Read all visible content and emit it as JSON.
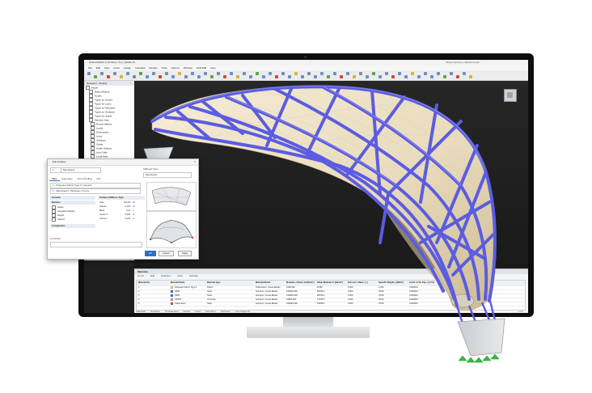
{
  "app": {
    "title": "Dlubal RFEM | 6.04.0012 | Tent_Saddle.rf6",
    "window_right": "Online Services | Dlubal Center",
    "menus": [
      "File",
      "Edit",
      "View",
      "Insert",
      "Assign",
      "Calculate",
      "Results",
      "Tools",
      "Options",
      "Window",
      "CAD-BIM",
      "Help"
    ]
  },
  "navigator": {
    "tabs": [
      "Navigator - Display"
    ],
    "items": [
      "Model",
      "Basic Objects",
      "Nodes",
      "Types for Nodes",
      "Types for Lines",
      "Types for Members",
      "Types for Surfaces",
      "Types for Solids",
      "Member Sets",
      "Result Objects",
      "Loads",
      "Dimensions",
      "Lines",
      "Surfaces",
      "Solids",
      "Guide Objects",
      "Line Grids",
      "Local Axes",
      "Results",
      "Mesh Nodes",
      "Values on Surfaces",
      "Member Results",
      "Extremes",
      "Support Reactions",
      "Result Sections",
      "Load Wizards"
    ],
    "bottom": [
      "Clipping Planes",
      "Views"
    ]
  },
  "colors": {
    "member": "#5b5ce0",
    "membrane": "#efe3c8",
    "support": "#2fbf3a",
    "background": "#1c1c1c"
  },
  "dialog": {
    "title": "Edit Surface",
    "fields": {
      "no": "1",
      "name": "Membrane",
      "stiffness_label": "Stiffness Type",
      "stiffness_value": "Membrane",
      "material": "1 - Polyester Fabric Type II | Generic",
      "thickness": "1 - Membrane | Thickness 1.0 mm"
    },
    "tabs": [
      "Main",
      "Geometry",
      "Form-Finding",
      "Info"
    ],
    "sections": [
      "General",
      "Options",
      "Assignment"
    ],
    "option_rows": [
      "Nodes",
      "Integrated Objects",
      "Hinges",
      "Support"
    ],
    "info_title": "Surface Stiffness Type",
    "info_rows": [
      {
        "label": "Area",
        "value": "162.93",
        "unit": "m²"
      },
      {
        "label": "Volume",
        "value": "0.163",
        "unit": "m³"
      },
      {
        "label": "Mass",
        "value": "0.21",
        "unit": "t"
      },
      {
        "label": "Center X",
        "value": "0.000",
        "unit": "m"
      },
      {
        "label": "Center Y",
        "value": "5.134",
        "unit": "m"
      }
    ],
    "comment_label": "Comment",
    "buttons": [
      "OK",
      "Cancel",
      "Apply"
    ]
  },
  "panel": {
    "title": "Materials",
    "menu": [
      "Go To",
      "Edit",
      "Selection",
      "View",
      "Settings"
    ],
    "columns": [
      "Material No.",
      "Material Name",
      "Material Type",
      "Material Model",
      "Modulus of Elast. E [N/mm²]",
      "Shear Modulus G [N/mm²]",
      "Poisson's Ratio v [-]",
      "Specific Weight γ [kN/m³]",
      "Coeff. of Th. Exp. α [1/°C]"
    ],
    "rows": [
      {
        "no": "1",
        "name": "Polyester Fabric Type II",
        "type": "Fabric",
        "model": "Orthotropic | Linear Elastic",
        "e": "1000.000",
        "g": "8.333",
        "v": "0.400",
        "w": "1.250",
        "a": "0.000010",
        "color": "#d9b75a"
      },
      {
        "no": "2",
        "name": "S355",
        "type": "Steel",
        "model": "Isotropic | Linear Elastic",
        "e": "210000.000",
        "g": "80769.2",
        "v": "0.300",
        "w": "78.50",
        "a": "0.000012",
        "color": "#3a6fc0"
      },
      {
        "no": "3",
        "name": "S235",
        "type": "Steel",
        "model": "Isotropic | Linear Elastic",
        "e": "210000.000",
        "g": "80769.2",
        "v": "0.300",
        "w": "78.50",
        "a": "0.000012",
        "color": "#3a6fc0"
      },
      {
        "no": "4",
        "name": "C30/37",
        "type": "Concrete",
        "model": "Isotropic | Linear Elastic",
        "e": "33000.000",
        "g": "13750.0",
        "v": "0.200",
        "w": "25.00",
        "a": "0.000010",
        "color": "#9a9a9a"
      },
      {
        "no": "5",
        "name": "Cable Steel",
        "type": "Steel",
        "model": "Isotropic | Linear Elastic",
        "e": "160000.000",
        "g": "61538.5",
        "v": "0.300",
        "w": "78.50",
        "a": "0.000012",
        "color": "#c84a3c"
      }
    ],
    "bottom_tabs": [
      "Materials",
      "Sections",
      "Thicknesses",
      "Nodes",
      "Lines",
      "Members",
      "Surfaces",
      "Line Supports"
    ],
    "status": "1 of 5"
  }
}
